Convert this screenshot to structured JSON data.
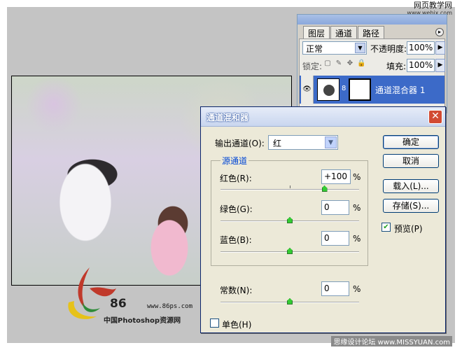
{
  "watermark_top": {
    "line1": "网页教学网",
    "line2": "www.webjx.com"
  },
  "watermark_bottom": "思缘设计论坛 www.MISSYUAN.com",
  "logo": {
    "number": "86",
    "url": "www.86ps.com",
    "name": "中国Photoshop资源网"
  },
  "layers_panel": {
    "tabs": [
      "图层",
      "通道",
      "路径"
    ],
    "blend_mode": "正常",
    "opacity_label": "不透明度:",
    "opacity_value": "100%",
    "lock_label": "锁定:",
    "fill_label": "填充:",
    "fill_value": "100%",
    "layer_name": "通道混合器 1"
  },
  "dialog": {
    "title": "通道混和器",
    "output_label": "输出通道(O):",
    "output_value": "红",
    "source_group": "源通道",
    "red_label": "红色(R):",
    "red_value": "+100",
    "green_label": "绿色(G):",
    "green_value": "0",
    "blue_label": "蓝色(B):",
    "blue_value": "0",
    "constant_label": "常数(N):",
    "constant_value": "0",
    "percent": "%",
    "monochrome_label": "单色(H)",
    "ok": "确定",
    "cancel": "取消",
    "load": "载入(L)...",
    "save": "存储(S)...",
    "preview_label": "预览(P)",
    "preview_checked": true,
    "monochrome_checked": false,
    "sliders": {
      "red": 100,
      "green": 0,
      "blue": 0,
      "constant": 0,
      "min": -200,
      "max": 200
    }
  }
}
